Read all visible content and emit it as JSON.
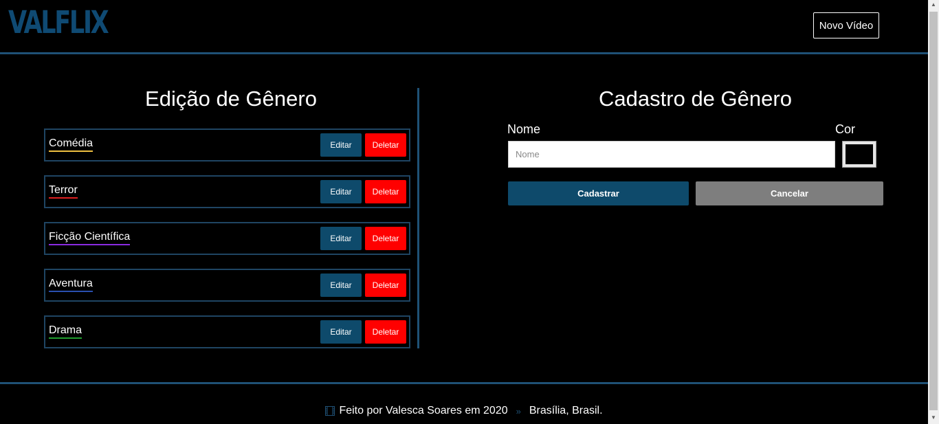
{
  "header": {
    "logo": "VALFLIX",
    "new_video_label": "Novo Vídeo"
  },
  "edit_section": {
    "title": "Edição de Gênero",
    "edit_label": "Editar",
    "delete_label": "Deletar",
    "genres": [
      {
        "name": "Comédia",
        "color": "#f0c040"
      },
      {
        "name": "Terror",
        "color": "#e02020"
      },
      {
        "name": "Ficção Científica",
        "color": "#8a2be2"
      },
      {
        "name": "Aventura",
        "color": "#2a4fb0"
      },
      {
        "name": "Drama",
        "color": "#22a030"
      }
    ]
  },
  "form": {
    "title": "Cadastro de Gênero",
    "name_label": "Nome",
    "color_label": "Cor",
    "name_placeholder": "Nome",
    "name_value": "",
    "color_value": "#000000",
    "submit_label": "Cadastrar",
    "cancel_label": "Cancelar"
  },
  "footer": {
    "credit": "Feito por Valesca Soares em 2020",
    "location": "Brasília, Brasil."
  }
}
